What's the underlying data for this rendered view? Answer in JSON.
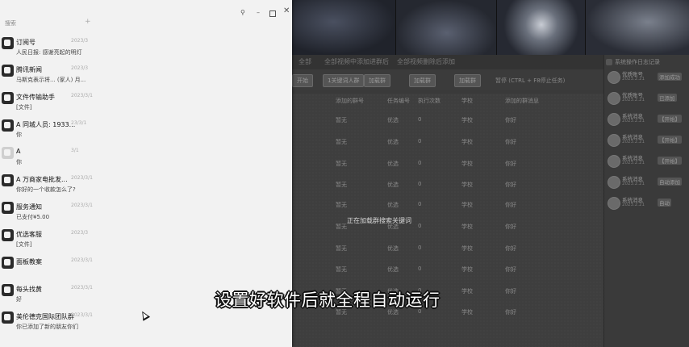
{
  "chat_window": {
    "search_label": "搜索",
    "search_plus": "+",
    "controls": {
      "pin": "⚲",
      "minimize": "–",
      "maximize": "",
      "close": "✕"
    },
    "items": [
      {
        "name": "订阅号",
        "preview": "人民日报: 感谢亮起的明灯",
        "time": "2023/3",
        "avatar": "dark"
      },
      {
        "name": "腾讯新闻",
        "preview": "马斯克表示将... (家人) 月...",
        "time": "2023/3",
        "avatar": "dark"
      },
      {
        "name": "文件传输助手",
        "preview": "[文件]",
        "time": "2023/3/1",
        "avatar": "dark"
      },
      {
        "name": "A 同城人员: 1933...",
        "preview": "你",
        "time": "23/3/1",
        "avatar": "dark"
      },
      {
        "name": "A",
        "preview": "你",
        "time": "3/1",
        "avatar": "light"
      },
      {
        "name": "A 万商家电批发...",
        "preview": "你好的一个收款怎么了?",
        "time": "2023/3/1",
        "avatar": "dark"
      },
      {
        "name": "服务通知",
        "preview": "已支付¥5.00",
        "time": "2023/3/1",
        "avatar": "dark"
      },
      {
        "name": "优选客服",
        "preview": "[文件]",
        "time": "2023/3",
        "avatar": "dark"
      },
      {
        "name": "面板教案",
        "preview": "",
        "time": "2023/3/1",
        "avatar": "dark"
      },
      {
        "name": "每头找黄",
        "preview": "好",
        "time": "2023/3/1",
        "avatar": "dark"
      },
      {
        "name": "美伦德克国际团队群",
        "preview": "你已添加了新的朋友你们",
        "time": "2023/3/1",
        "avatar": "dark"
      }
    ]
  },
  "background_app": {
    "menu": [
      "全部",
      "全部视频中添加进群后",
      "全部视频删除后添加"
    ],
    "toolbar": {
      "buttons": [
        "开始",
        "1关键词人群",
        "加载群",
        "加载群",
        "加载群"
      ],
      "hint": "暂停 (CTRL + F8停止任务)"
    },
    "grid_headers": [
      "添加的群号",
      "任务编号",
      "执行次数",
      "学校",
      "添加的群消息"
    ],
    "grid_rows": [
      [
        "暂无",
        "优选",
        "0",
        "学校",
        "你好"
      ],
      [
        "暂无",
        "优选",
        "0",
        "学校",
        "你好"
      ],
      [
        "暂无",
        "优选",
        "0",
        "学校",
        "你好"
      ],
      [
        "暂无",
        "优选",
        "0",
        "学校",
        "你好"
      ],
      [
        "暂无",
        "优选",
        "0",
        "学校",
        "你好"
      ],
      [
        "暂无",
        "优选",
        "0",
        "学校",
        "你好"
      ],
      [
        "暂无",
        "优选",
        "0",
        "学校",
        "你好"
      ],
      [
        "暂无",
        "优选",
        "0",
        "学校",
        "你好"
      ],
      [
        "暂无",
        "优选",
        "0",
        "学校",
        "你好"
      ],
      [
        "暂无",
        "优选",
        "0",
        "学校",
        "你好"
      ]
    ],
    "notice": "正在加载群搜索关键词",
    "side_panel": {
      "title": "系统操作日志记录",
      "entries": [
        {
          "name": "优质账号",
          "date": "2023.2.21",
          "msg": "添加成功"
        },
        {
          "name": "优质账号",
          "date": "2023.2.21",
          "msg": "已添加"
        },
        {
          "name": "系统消息",
          "date": "2023.2.21",
          "msg": "【开始】"
        },
        {
          "name": "系统消息",
          "date": "2023.2.21",
          "msg": "【开始】"
        },
        {
          "name": "系统消息",
          "date": "2023.2.21",
          "msg": "【开始】"
        },
        {
          "name": "系统消息",
          "date": "2023.2.21",
          "msg": "自动添加"
        },
        {
          "name": "系统消息",
          "date": "2023.2.21",
          "msg": "自动"
        }
      ]
    }
  },
  "subtitle": "设置好软件后就全程自动运行"
}
